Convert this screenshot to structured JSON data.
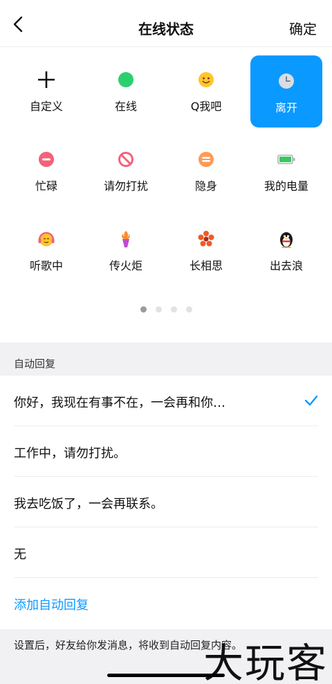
{
  "nav": {
    "title": "在线状态",
    "confirm": "确定"
  },
  "statuses": [
    {
      "label": "自定义",
      "icon": "plus-icon"
    },
    {
      "label": "在线",
      "icon": "green-dot-icon"
    },
    {
      "label": "Q我吧",
      "icon": "smile-face-icon"
    },
    {
      "label": "离开",
      "icon": "clock-icon",
      "selected": true
    },
    {
      "label": "忙碌",
      "icon": "busy-icon"
    },
    {
      "label": "请勿打扰",
      "icon": "no-disturb-icon"
    },
    {
      "label": "隐身",
      "icon": "invisible-icon"
    },
    {
      "label": "我的电量",
      "icon": "battery-icon"
    },
    {
      "label": "听歌中",
      "icon": "headphones-face-icon"
    },
    {
      "label": "传火炬",
      "icon": "torch-icon"
    },
    {
      "label": "长相思",
      "icon": "flower-icon"
    },
    {
      "label": "出去浪",
      "icon": "penguin-icon"
    }
  ],
  "pager": {
    "pages": 4,
    "current": 1
  },
  "auto_reply": {
    "header": "自动回复",
    "options": [
      {
        "text": "你好，我现在有事不在，一会再和你…",
        "selected": true
      },
      {
        "text": "工作中，请勿打扰。"
      },
      {
        "text": "我去吃饭了，一会再联系。"
      },
      {
        "text": "无"
      }
    ],
    "add_label": "添加自动回复"
  },
  "footer": {
    "note": "设置后，好友给你发消息，将收到自动回复内容。",
    "watermark": "大玩客"
  },
  "colors": {
    "accent": "#0a99ff",
    "online": "#2ccf6e",
    "busy": "#f2627a",
    "invisible": "#ff9a55"
  }
}
